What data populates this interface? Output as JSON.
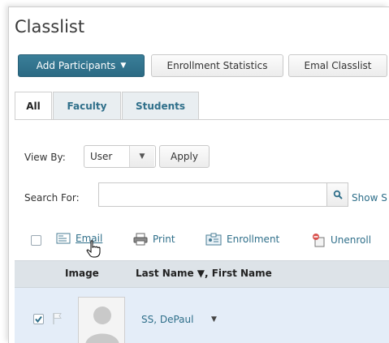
{
  "page": {
    "title": "Classlist"
  },
  "toolbar": {
    "add_participants": "Add Participants",
    "enrollment_statistics": "Enrollment Statistics",
    "email_classlist": "Emal Classlist"
  },
  "tabs": [
    {
      "label": "All",
      "active": true
    },
    {
      "label": "Faculty",
      "active": false
    },
    {
      "label": "Students",
      "active": false
    }
  ],
  "filters": {
    "view_by_label": "View By:",
    "view_by_value": "User",
    "apply_label": "Apply",
    "search_label": "Search For:",
    "search_value": "",
    "show_label": "Show S"
  },
  "actions": {
    "email": "Email",
    "print": "Print",
    "enrollment": "Enrollment",
    "unenroll": "Unenroll"
  },
  "table": {
    "columns": {
      "image": "Image",
      "name": "Last Name ▼, First Name"
    },
    "rows": [
      {
        "name": "SS, DePaul",
        "checked": true
      }
    ]
  },
  "colors": {
    "primary": "#2b6a84",
    "link": "#2f6f8a",
    "row_selected": "#e4edf8",
    "header": "#dde3e8"
  }
}
